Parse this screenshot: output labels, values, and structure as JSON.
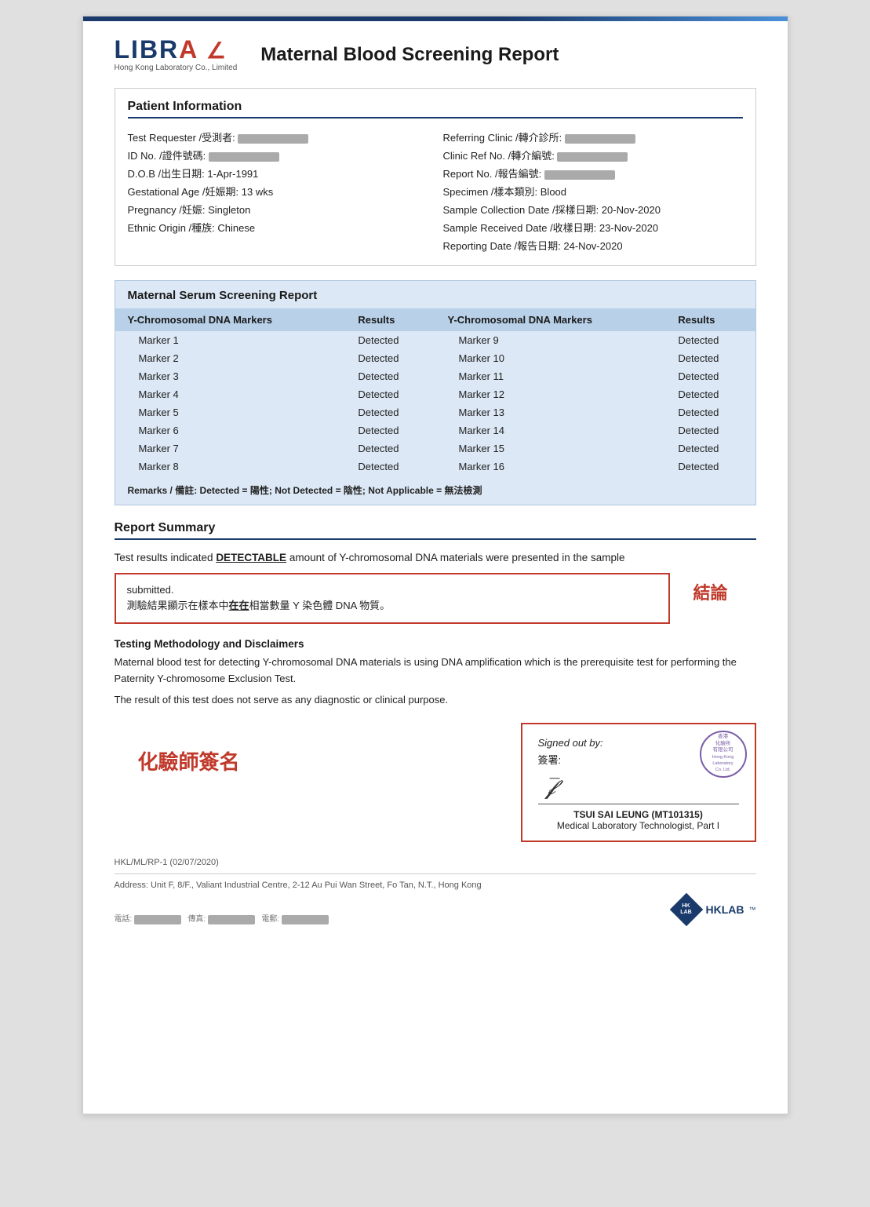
{
  "topbar": {},
  "header": {
    "logo": "LIBRA",
    "logo_subtitle": "Hong Kong Laboratory Co., Limited",
    "report_title": "Maternal Blood Screening Report"
  },
  "patient_info": {
    "section_title": "Patient Information",
    "left": [
      {
        "label": "Test Requester /受測者:",
        "value": "REDACTED"
      },
      {
        "label": "ID No. /證件號碼:",
        "value": "REDACTED"
      },
      {
        "label": "D.O.B /出生日期:",
        "value": "1-Apr-1991"
      },
      {
        "label": "Gestational Age /妊娠期:",
        "value": "13 wks"
      },
      {
        "label": "Pregnancy /妊娠:",
        "value": "Singleton"
      },
      {
        "label": "Ethnic Origin /種族:",
        "value": "Chinese"
      }
    ],
    "right": [
      {
        "label": "Referring Clinic /轉介診所:",
        "value": "REDACTED"
      },
      {
        "label": "Clinic Ref No. /轉介編號:",
        "value": "REDACTED"
      },
      {
        "label": "Report No. /報告編號:",
        "value": "REDACTED"
      },
      {
        "label": "Specimen /樣本類別:",
        "value": "Blood"
      },
      {
        "label": "Sample Collection Date /採樣日期:",
        "value": "20-Nov-2020"
      },
      {
        "label": "Sample Received Date /收樣日期:",
        "value": "23-Nov-2020"
      },
      {
        "label": "Reporting Date /報告日期:",
        "value": "24-Nov-2020"
      }
    ]
  },
  "screening": {
    "section_title": "Maternal Serum Screening Report",
    "col1_header": "Y-Chromosomal DNA Markers",
    "col2_header": "Results",
    "col3_header": "Y-Chromosomal DNA Markers",
    "col4_header": "Results",
    "left_markers": [
      {
        "marker": "Marker 1",
        "result": "Detected"
      },
      {
        "marker": "Marker 2",
        "result": "Detected"
      },
      {
        "marker": "Marker 3",
        "result": "Detected"
      },
      {
        "marker": "Marker 4",
        "result": "Detected"
      },
      {
        "marker": "Marker 5",
        "result": "Detected"
      },
      {
        "marker": "Marker 6",
        "result": "Detected"
      },
      {
        "marker": "Marker 7",
        "result": "Detected"
      },
      {
        "marker": "Marker 8",
        "result": "Detected"
      }
    ],
    "right_markers": [
      {
        "marker": "Marker 9",
        "result": "Detected"
      },
      {
        "marker": "Marker 10",
        "result": "Detected"
      },
      {
        "marker": "Marker 11",
        "result": "Detected"
      },
      {
        "marker": "Marker 12",
        "result": "Detected"
      },
      {
        "marker": "Marker 13",
        "result": "Detected"
      },
      {
        "marker": "Marker 14",
        "result": "Detected"
      },
      {
        "marker": "Marker 15",
        "result": "Detected"
      },
      {
        "marker": "Marker 16",
        "result": "Detected"
      }
    ],
    "remarks": "Remarks / 備註: Detected = 陽性; Not Detected = 陰性; Not Applicable = 無法檢測"
  },
  "summary": {
    "section_title": "Report Summary",
    "text_line1": "Test results indicated ",
    "detectable": "DETECTABLE",
    "text_line2": " amount of Y-chromosomal DNA materials were presented in the sample",
    "text_line3": "submitted.",
    "chinese_text1": "測驗結果顯示在樣本中",
    "chinese_underline": "在在",
    "chinese_text2": "相當數量 Y 染色體 DNA 物質。",
    "conclusion_label": "結論"
  },
  "methodology": {
    "title": "Testing Methodology and Disclaimers",
    "text1": "Maternal blood test for detecting Y-chromosomal DNA materials is using DNA amplification which is the prerequisite test for performing the Paternity Y-chromosome Exclusion Test.",
    "text2": "The result of this test does not serve as any diagnostic or clinical purpose."
  },
  "signature": {
    "chemist_label": "化驗師簽名",
    "signed_out_by": "Signed out by:",
    "signed_out_by_zh": "簽署:",
    "signer_name": "TSUI SAI LEUNG (MT101315)",
    "signer_title": "Medical Laboratory Technologist, Part I",
    "stamp_text": "香港\n化驗所\n有限公司\nHong Kong\nLaboratory Co.\nLimited"
  },
  "footer": {
    "ref": "HKL/ML/RP-1 (02/07/2020)",
    "address": "Address: Unit F, 8/F., Valiant Industrial Centre, 2-12 Au Pui Wan Street, Fo Tan, N.T., Hong Kong",
    "contacts": "電話: (redacted)   傳真: (redacted)   電郵: (redacted)"
  }
}
